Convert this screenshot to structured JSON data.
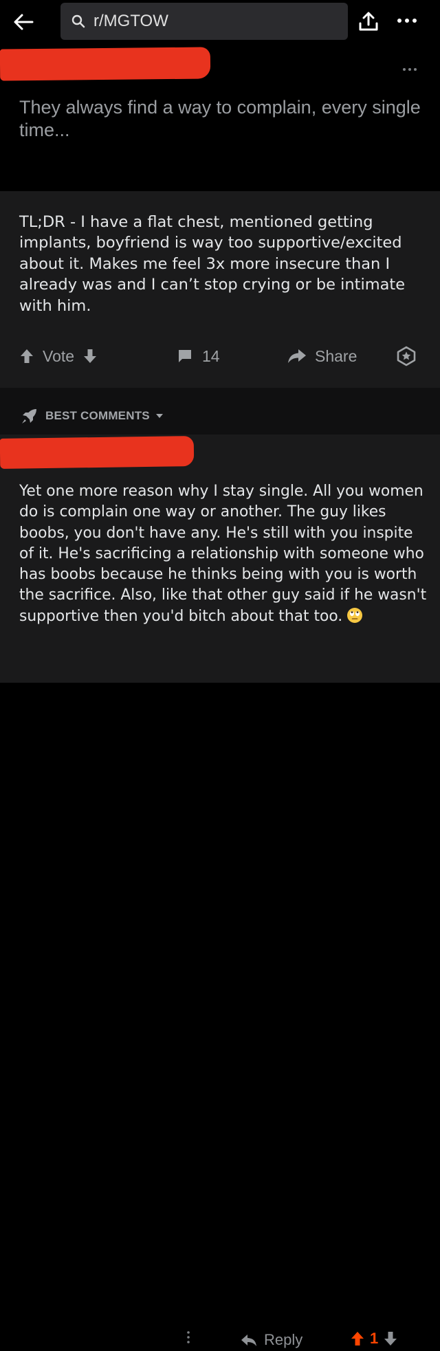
{
  "header": {
    "search_text": "r/MGTOW"
  },
  "post": {
    "title": "They always find a way to complain, every single time...",
    "body": "TL;DR - I have a flat chest, mentioned getting implants, boyfriend is way too supportive/excited about it. Makes me feel 3x more insecure than I already was and I can’t stop crying or be intimate with him.",
    "vote_label": "Vote",
    "comment_count": "14",
    "share_label": "Share"
  },
  "comments": {
    "sort_label": "BEST COMMENTS",
    "top_comment": {
      "text": "Yet one more reason why I stay single. All you women do is complain one way or another. The guy likes boobs, you don't have any. He's still with you inspite of it. He's sacrificing a relationship with someone who has boobs because he thinks being with you is worth the sacrifice. Also, like that other guy said if he wasn't supportive then you'd bitch about that too.",
      "reply_label": "Reply",
      "score": "1"
    }
  },
  "colors": {
    "background": "#000000",
    "card": "#1a1a1b",
    "text": "#e4e6e8",
    "muted": "#a0a3a6",
    "upvote": "#ff4500",
    "redaction": "#e8331e"
  },
  "icons": [
    "back-arrow-icon",
    "search-icon",
    "upload-icon",
    "more-icon",
    "upvote-icon",
    "downvote-icon",
    "comment-icon",
    "share-icon",
    "award-icon",
    "rocket-icon",
    "chevron-down-icon",
    "rolling-eyes-emoji",
    "reply-icon"
  ]
}
